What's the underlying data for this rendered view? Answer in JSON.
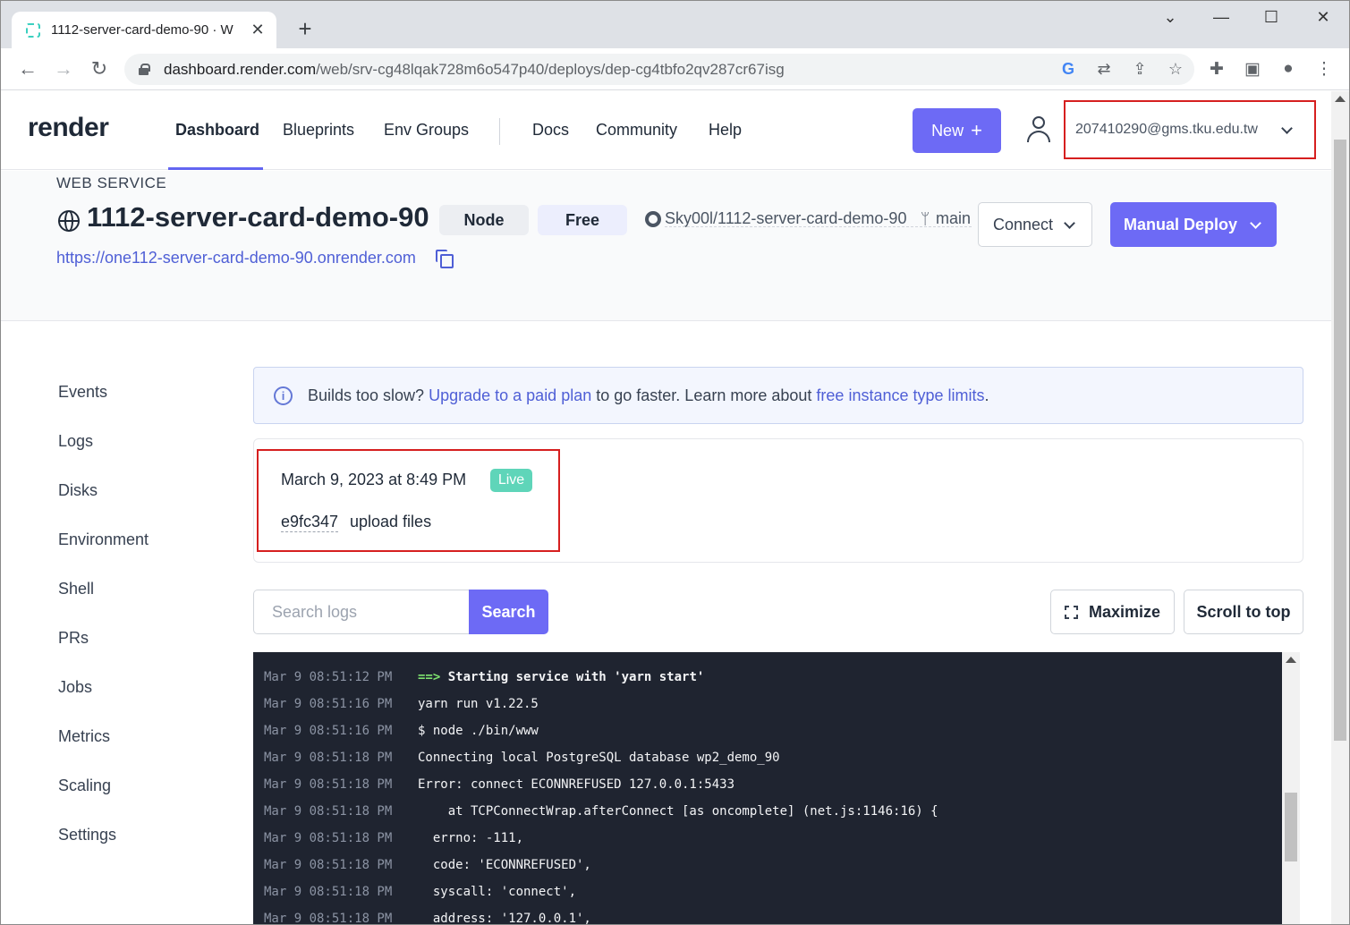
{
  "browser": {
    "tab_title": "1112-server-card-demo-90 · W",
    "tab_close": "✕",
    "new_tab": "+",
    "url_host": "dashboard.render.com",
    "url_path": "/web/srv-cg48lqak728m6o547p40/deploys/dep-cg4tbfo2qv287cr67isg"
  },
  "header": {
    "logo": "render",
    "nav": [
      "Dashboard",
      "Blueprints",
      "Env Groups",
      "Docs",
      "Community",
      "Help"
    ],
    "new_label": "New",
    "new_plus": "+",
    "account_email": "207410290@gms.tku.edu.tw"
  },
  "service": {
    "type_label": "WEB SERVICE",
    "name": "1112-server-card-demo-90",
    "runtime": "Node",
    "plan": "Free",
    "repo": "Sky00l/1112-server-card-demo-90",
    "branch": "main",
    "connect_label": "Connect",
    "deploy_label": "Manual Deploy",
    "url": "https://one112-server-card-demo-90.onrender.com"
  },
  "sidebar": {
    "items": [
      "Events",
      "Logs",
      "Disks",
      "Environment",
      "Shell",
      "PRs",
      "Jobs",
      "Metrics",
      "Scaling",
      "Settings"
    ]
  },
  "banner": {
    "prefix": "Builds too slow?",
    "link1": "Upgrade to a paid plan",
    "middle": "to go faster. Learn more about",
    "link2": "free instance type limits",
    "suffix": "."
  },
  "deploy": {
    "date": "March 9, 2023 at 8:49 PM",
    "status": "Live",
    "commit_hash": "e9fc347",
    "commit_message": "upload files"
  },
  "logs_toolbar": {
    "search_placeholder": "Search logs",
    "search_label": "Search",
    "maximize_label": "Maximize",
    "scroll_top_label": "Scroll to top"
  },
  "logs": [
    {
      "ts": "Mar 9 08:51:12 PM",
      "arrow": "==>",
      "msg": " Starting service with 'yarn start'"
    },
    {
      "ts": "Mar 9 08:51:16 PM",
      "arrow": "",
      "msg": "yarn run v1.22.5"
    },
    {
      "ts": "Mar 9 08:51:16 PM",
      "arrow": "",
      "msg": "$ node ./bin/www"
    },
    {
      "ts": "Mar 9 08:51:18 PM",
      "arrow": "",
      "msg": "Connecting local PostgreSQL database wp2_demo_90"
    },
    {
      "ts": "Mar 9 08:51:18 PM",
      "arrow": "",
      "msg": "Error: connect ECONNREFUSED 127.0.0.1:5433"
    },
    {
      "ts": "Mar 9 08:51:18 PM",
      "arrow": "",
      "msg": "    at TCPConnectWrap.afterConnect [as oncomplete] (net.js:1146:16) {"
    },
    {
      "ts": "Mar 9 08:51:18 PM",
      "arrow": "",
      "msg": "  errno: -111,"
    },
    {
      "ts": "Mar 9 08:51:18 PM",
      "arrow": "",
      "msg": "  code: 'ECONNREFUSED',"
    },
    {
      "ts": "Mar 9 08:51:18 PM",
      "arrow": "",
      "msg": "  syscall: 'connect',"
    },
    {
      "ts": "Mar 9 08:51:18 PM",
      "arrow": "",
      "msg": "  address: '127.0.0.1',"
    }
  ]
}
